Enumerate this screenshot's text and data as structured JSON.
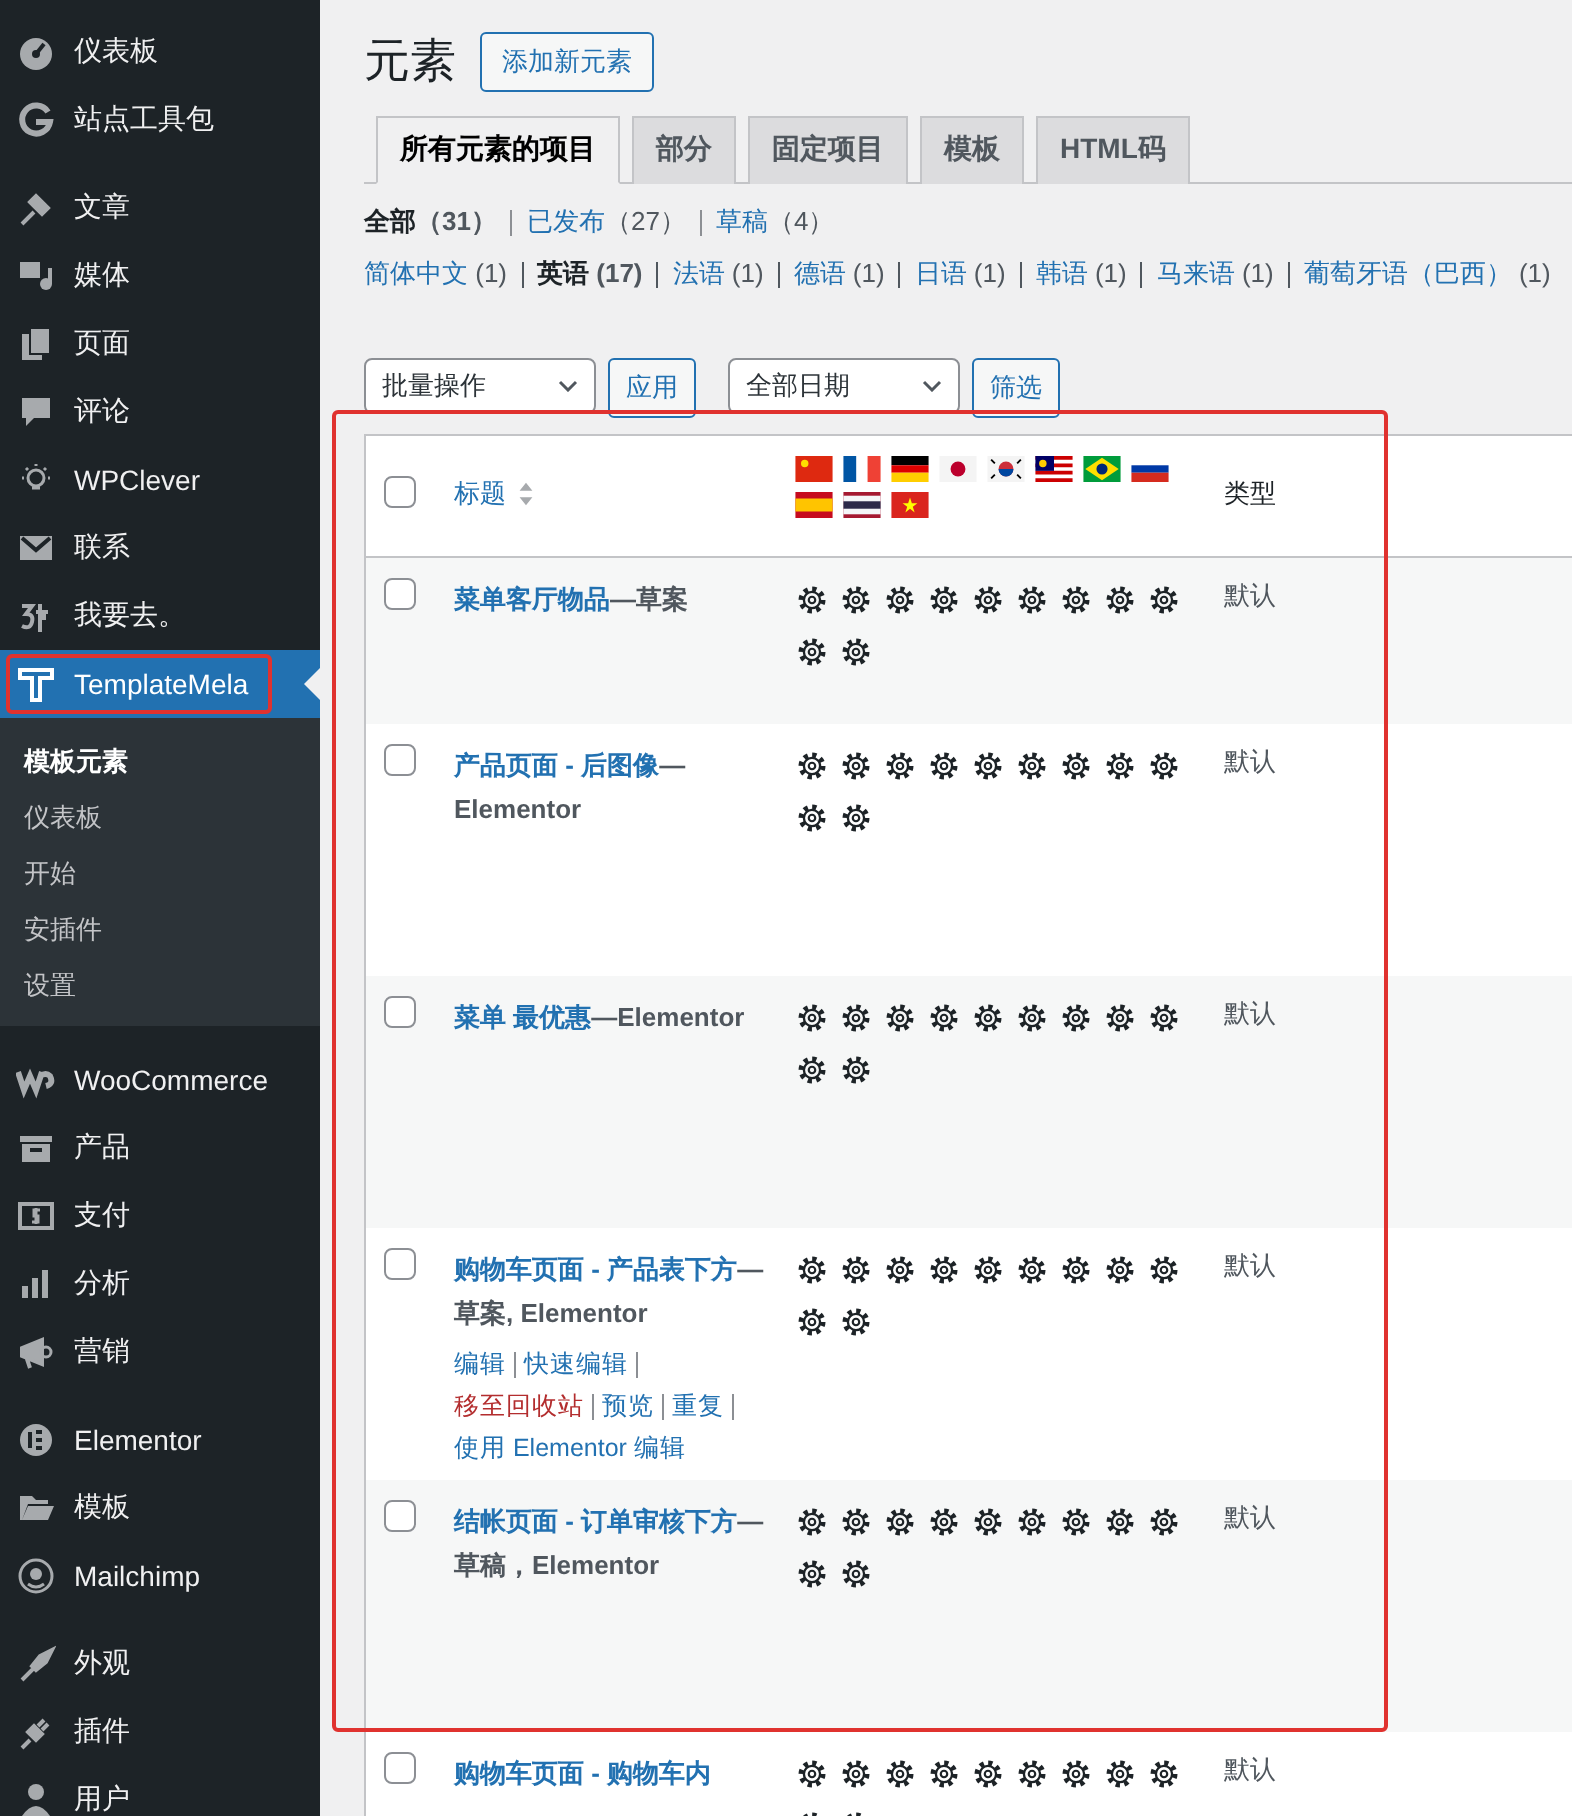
{
  "sidebar": {
    "sections": [
      [
        {
          "label": "仪表板",
          "kind": "gauge",
          "selected": false
        },
        {
          "label": "站点工具包",
          "kind": "g",
          "selected": false
        }
      ],
      [
        {
          "label": "文章",
          "kind": "pin",
          "selected": false
        },
        {
          "label": "媒体",
          "kind": "media",
          "selected": false
        },
        {
          "label": "页面",
          "kind": "pages",
          "selected": false
        },
        {
          "label": "评论",
          "kind": "comment",
          "selected": false
        },
        {
          "label": "WPClever",
          "kind": "bulb",
          "selected": false
        },
        {
          "label": "联系",
          "kind": "mail",
          "selected": false
        },
        {
          "label": "我要去。",
          "kind": "glyph",
          "selected": false
        },
        {
          "label": "TemplateMela",
          "kind": "t",
          "selected": true,
          "children": [
            {
              "label": "模板元素",
              "selected": true
            },
            {
              "label": "仪表板",
              "selected": false
            },
            {
              "label": "开始",
              "selected": false
            },
            {
              "label": "安插件",
              "selected": false
            },
            {
              "label": "设置",
              "selected": false
            }
          ]
        }
      ],
      [
        {
          "label": "WooCommerce",
          "kind": "woo",
          "selected": false
        },
        {
          "label": "产品",
          "kind": "archive",
          "selected": false
        },
        {
          "label": "支付",
          "kind": "dollar",
          "selected": false
        },
        {
          "label": "分析",
          "kind": "bars",
          "selected": false
        },
        {
          "label": "营销",
          "kind": "megaphone",
          "selected": false
        }
      ],
      [
        {
          "label": "Elementor",
          "kind": "elementor",
          "selected": false
        },
        {
          "label": "模板",
          "kind": "folder",
          "selected": false
        },
        {
          "label": "Mailchimp",
          "kind": "monkey",
          "selected": false
        }
      ],
      [
        {
          "label": "外观",
          "kind": "brush",
          "selected": false
        },
        {
          "label": "插件",
          "kind": "plug",
          "selected": false
        },
        {
          "label": "用户",
          "kind": "user",
          "selected": false
        }
      ]
    ]
  },
  "page": {
    "title": "元素",
    "add_button": "添加新元素"
  },
  "tabs": [
    {
      "label": "所有元素的项目",
      "selected": true
    },
    {
      "label": "部分",
      "selected": false
    },
    {
      "label": "固定项目",
      "selected": false
    },
    {
      "label": "模板",
      "selected": false
    },
    {
      "label": "HTML码",
      "selected": false
    }
  ],
  "status_views": [
    {
      "label": "全部",
      "count": "（31）",
      "selected": true
    },
    {
      "label": "已发布",
      "count": "（27）",
      "selected": false
    },
    {
      "label": "草稿",
      "count": "（4）",
      "selected": false
    }
  ],
  "language_views": [
    {
      "label": "简体中文",
      "count": "(1)",
      "selected": false
    },
    {
      "label": "英语",
      "count": "(17)",
      "selected": true
    },
    {
      "label": "法语",
      "count": "(1)",
      "selected": false
    },
    {
      "label": "德语",
      "count": "(1)",
      "selected": false
    },
    {
      "label": "日语",
      "count": "(1)",
      "selected": false
    },
    {
      "label": "韩语",
      "count": "(1)",
      "selected": false
    },
    {
      "label": "马来语",
      "count": "(1)",
      "selected": false
    },
    {
      "label": "葡萄牙语（巴西）",
      "count": "(1)",
      "selected": false
    }
  ],
  "bulk_actions": {
    "select": "批量操作",
    "apply": "应用"
  },
  "date_filter": {
    "select": "全部日期",
    "filter": "筛选"
  },
  "table": {
    "select_all_checked": false,
    "columns": {
      "title": "标题",
      "type": "类型"
    },
    "flags": [
      {
        "kind": "cn"
      },
      {
        "kind": "fr"
      },
      {
        "kind": "de"
      },
      {
        "kind": "jp"
      },
      {
        "kind": "kr"
      },
      {
        "kind": "my"
      },
      {
        "kind": "br"
      },
      {
        "kind": "ru"
      },
      {
        "kind": "es"
      },
      {
        "kind": "th"
      },
      {
        "kind": "vn"
      }
    ],
    "rows": [
      {
        "title": "菜单客厅物品",
        "suffix": "—草案",
        "type": "默认",
        "checked": false
      },
      {
        "title": "产品页面 - 后图像",
        "suffix": "—Elementor",
        "type": "默认",
        "checked": false
      },
      {
        "title": "菜单 最优惠",
        "suffix": "—Elementor",
        "type": "默认",
        "checked": false
      },
      {
        "title": "购物车页面 - 产品表下方",
        "suffix": "—草案, Elementor",
        "type": "默认",
        "checked": false,
        "actions": [
          {
            "label": "编辑",
            "kind": "link"
          },
          {
            "label": "快速编辑",
            "kind": "link"
          },
          {
            "label": "移至回收站",
            "kind": "trash"
          },
          {
            "label": "预览",
            "kind": "link"
          },
          {
            "label": "重复",
            "kind": "link"
          },
          {
            "label": "使用 Elementor 编辑",
            "kind": "link"
          }
        ]
      },
      {
        "title": "结帐页面 - 订单审核下方",
        "suffix": "— 草稿，Elementor",
        "type": "默认",
        "checked": false
      },
      {
        "title": "购物车页面 - 购物车内",
        "suffix": "",
        "type": "默认",
        "checked": false
      }
    ]
  }
}
